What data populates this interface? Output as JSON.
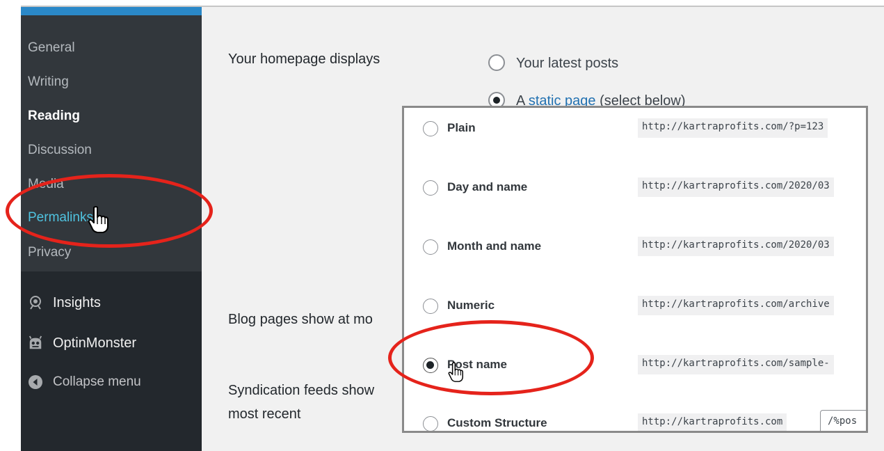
{
  "sidebar": {
    "submenu": [
      {
        "label": "General"
      },
      {
        "label": "Writing"
      },
      {
        "label": "Reading"
      },
      {
        "label": "Discussion"
      },
      {
        "label": "Media"
      },
      {
        "label": "Permalinks"
      },
      {
        "label": "Privacy"
      }
    ],
    "menu": [
      {
        "label": "Insights",
        "icon": "insights-icon"
      },
      {
        "label": "OptinMonster",
        "icon": "optinmonster-icon"
      },
      {
        "label": "Collapse menu",
        "icon": "collapse-arrow-icon"
      }
    ]
  },
  "main": {
    "homepage_displays_label": "Your homepage displays",
    "latest_posts_label": "Your latest posts",
    "static_page_prefix": "A",
    "static_page_link": "static page",
    "static_page_suffix": "(select below)",
    "blog_pages_label": "Blog pages show at mo",
    "syndication_line1": "Syndication feeds show",
    "syndication_line2": "most recent"
  },
  "permalink_options": [
    {
      "label": "Plain",
      "example": "http://kartraprofits.com/?p=123",
      "checked": false
    },
    {
      "label": "Day and name",
      "example": "http://kartraprofits.com/2020/03",
      "checked": false
    },
    {
      "label": "Month and name",
      "example": "http://kartraprofits.com/2020/03",
      "checked": false
    },
    {
      "label": "Numeric",
      "example": "http://kartraprofits.com/archive",
      "checked": false
    },
    {
      "label": "Post name",
      "example": "http://kartraprofits.com/sample-",
      "checked": true
    },
    {
      "label": "Custom Structure",
      "example": "http://kartraprofits.com",
      "value": "/%pos",
      "checked": false
    }
  ],
  "colors": {
    "annotation": "#e5231b",
    "sidebar_bg": "#23282d",
    "submenu_bg": "#32373c",
    "accent": "#2a88c8",
    "active_link": "#4fc3e0"
  }
}
